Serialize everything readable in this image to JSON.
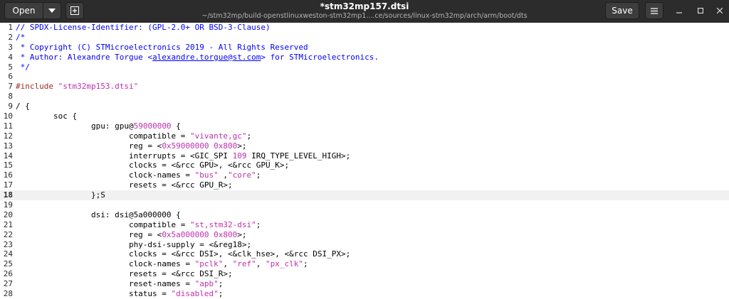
{
  "header": {
    "open_label": "Open",
    "save_label": "Save",
    "title": "*stm32mp157.dtsi",
    "subtitle": "~/stm32mp/build-openstlinuxweston-stm32mp1....ce/sources/linux-stm32mp/arch/arm/boot/dts"
  },
  "editor": {
    "current_line": 18,
    "lines": [
      {
        "n": "1",
        "t": "// SPDX-License-Identifier: (GPL-2.0+ OR BSD-3-Clause)"
      },
      {
        "n": "2",
        "t": "/*"
      },
      {
        "n": "3",
        "t": " * Copyright (C) STMicroelectronics 2019 - All Rights Reserved"
      },
      {
        "n": "4",
        "t": " * Author: Alexandre Torgue <alexandre.torgue@st.com> for STMicroelectronics."
      },
      {
        "n": "5",
        "t": " */"
      },
      {
        "n": "6",
        "t": ""
      },
      {
        "n": "7",
        "t": "#include \"stm32mp153.dtsi\""
      },
      {
        "n": "8",
        "t": ""
      },
      {
        "n": "9",
        "t": "/ {"
      },
      {
        "n": "10",
        "t": "        soc {"
      },
      {
        "n": "11",
        "t": "                gpu: gpu@59000000 {"
      },
      {
        "n": "12",
        "t": "                        compatible = \"vivante,gc\";"
      },
      {
        "n": "13",
        "t": "                        reg = <0x59000000 0x800>;"
      },
      {
        "n": "14",
        "t": "                        interrupts = <GIC_SPI 109 IRQ_TYPE_LEVEL_HIGH>;"
      },
      {
        "n": "15",
        "t": "                        clocks = <&rcc GPU>, <&rcc GPU_K>;"
      },
      {
        "n": "16",
        "t": "                        clock-names = \"bus\" ,\"core\";"
      },
      {
        "n": "17",
        "t": "                        resets = <&rcc GPU_R>;"
      },
      {
        "n": "18",
        "t": "                };S"
      },
      {
        "n": "19",
        "t": ""
      },
      {
        "n": "20",
        "t": "                dsi: dsi@5a000000 {"
      },
      {
        "n": "21",
        "t": "                        compatible = \"st,stm32-dsi\";"
      },
      {
        "n": "22",
        "t": "                        reg = <0x5a000000 0x800>;"
      },
      {
        "n": "23",
        "t": "                        phy-dsi-supply = <&reg18>;"
      },
      {
        "n": "24",
        "t": "                        clocks = <&rcc DSI>, <&clk_hse>, <&rcc DSI_PX>;"
      },
      {
        "n": "25",
        "t": "                        clock-names = \"pclk\", \"ref\", \"px_clk\";"
      },
      {
        "n": "26",
        "t": "                        resets = <&rcc DSI_R>;"
      },
      {
        "n": "27",
        "t": "                        reset-names = \"apb\";"
      },
      {
        "n": "28",
        "t": "                        status = \"disabled\";"
      }
    ]
  },
  "icons": {
    "open_arrow": "chevron-down-icon",
    "new_tab": "new-tab-icon",
    "menu": "hamburger-menu-icon",
    "minimize": "minimize-icon",
    "maximize": "maximize-icon",
    "close": "close-icon"
  },
  "colors": {
    "header_bg": "#2c2c2c",
    "string": "#c030b0",
    "comment": "#0000ff",
    "preprocessor": "#a52a2a"
  }
}
